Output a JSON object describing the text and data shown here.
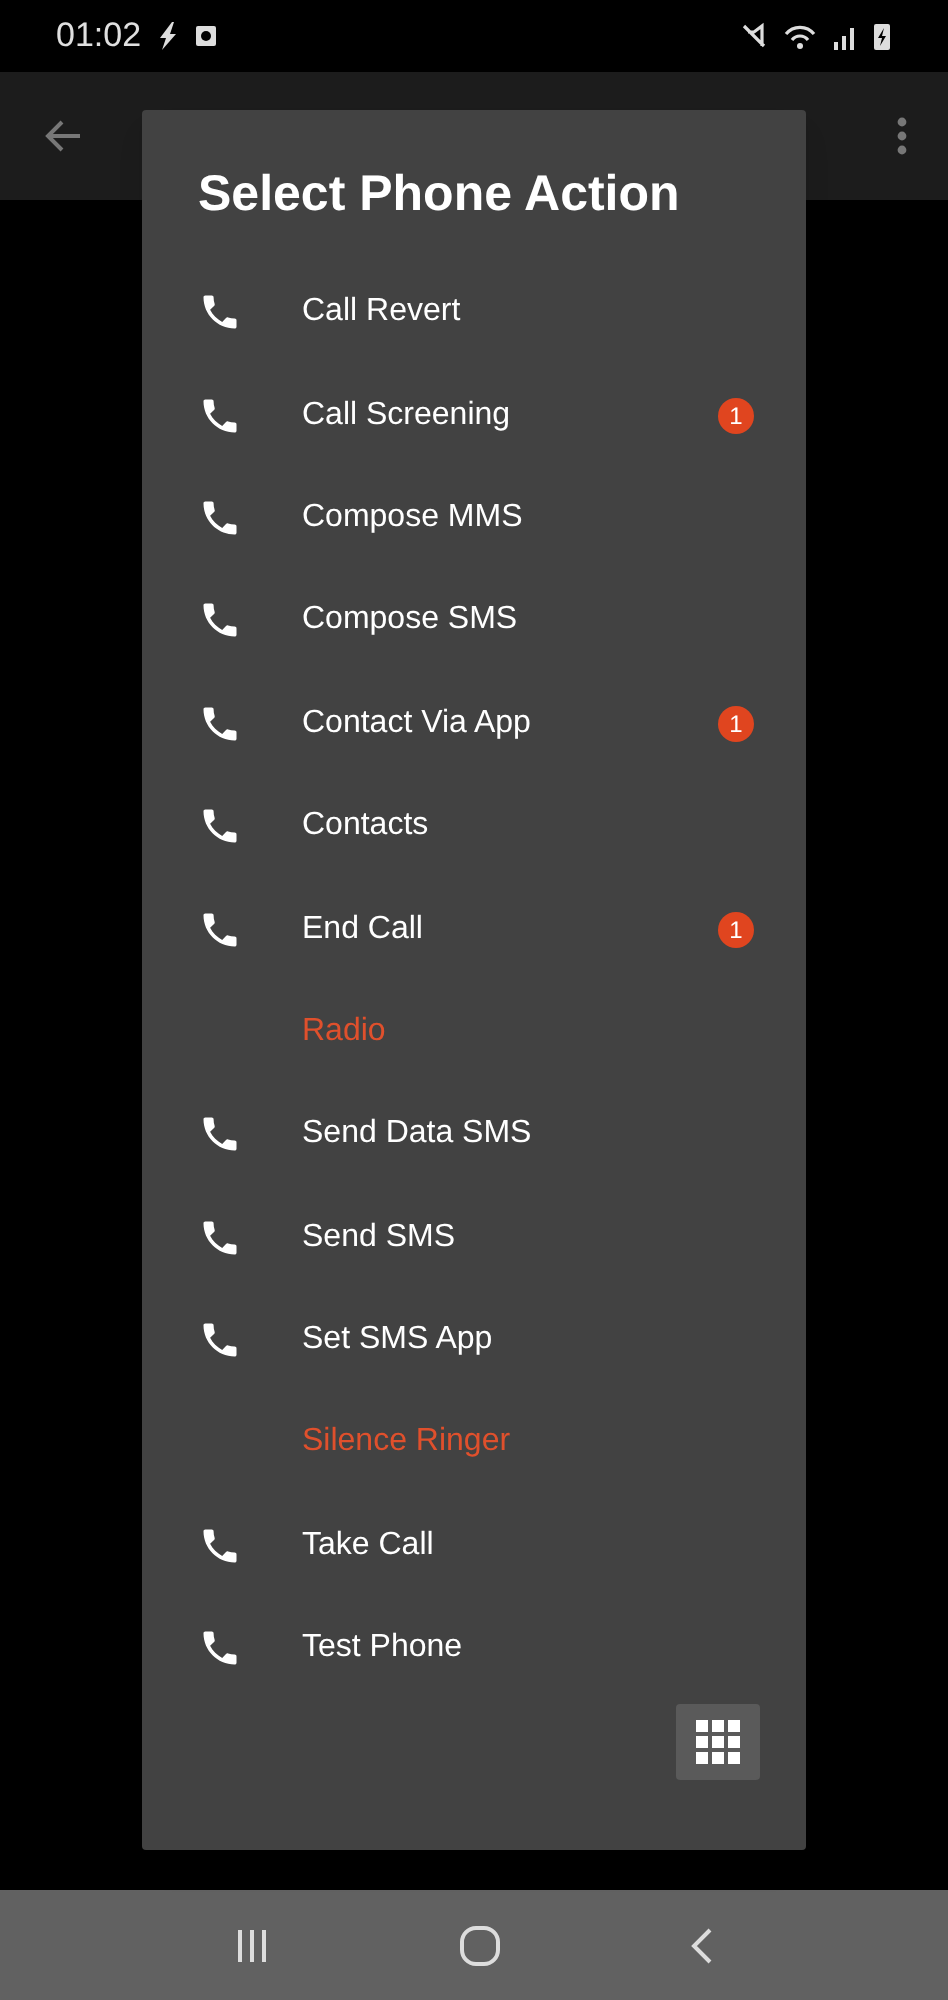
{
  "status_bar": {
    "time": "01:02"
  },
  "dialog": {
    "title": "Select Phone Action",
    "items": [
      {
        "label": "Call Revert",
        "kind": "action"
      },
      {
        "label": "Call Screening",
        "kind": "action",
        "badge": "1"
      },
      {
        "label": "Compose MMS",
        "kind": "action"
      },
      {
        "label": "Compose SMS",
        "kind": "action"
      },
      {
        "label": "Contact Via App",
        "kind": "action",
        "badge": "1"
      },
      {
        "label": "Contacts",
        "kind": "action"
      },
      {
        "label": "End Call",
        "kind": "action",
        "badge": "1"
      },
      {
        "label": "Radio",
        "kind": "unavailable"
      },
      {
        "label": "Send Data SMS",
        "kind": "action"
      },
      {
        "label": "Send SMS",
        "kind": "action"
      },
      {
        "label": "Set SMS App",
        "kind": "action"
      },
      {
        "label": "Silence Ringer",
        "kind": "unavailable"
      },
      {
        "label": "Take Call",
        "kind": "action"
      },
      {
        "label": "Test Phone",
        "kind": "action"
      }
    ]
  }
}
